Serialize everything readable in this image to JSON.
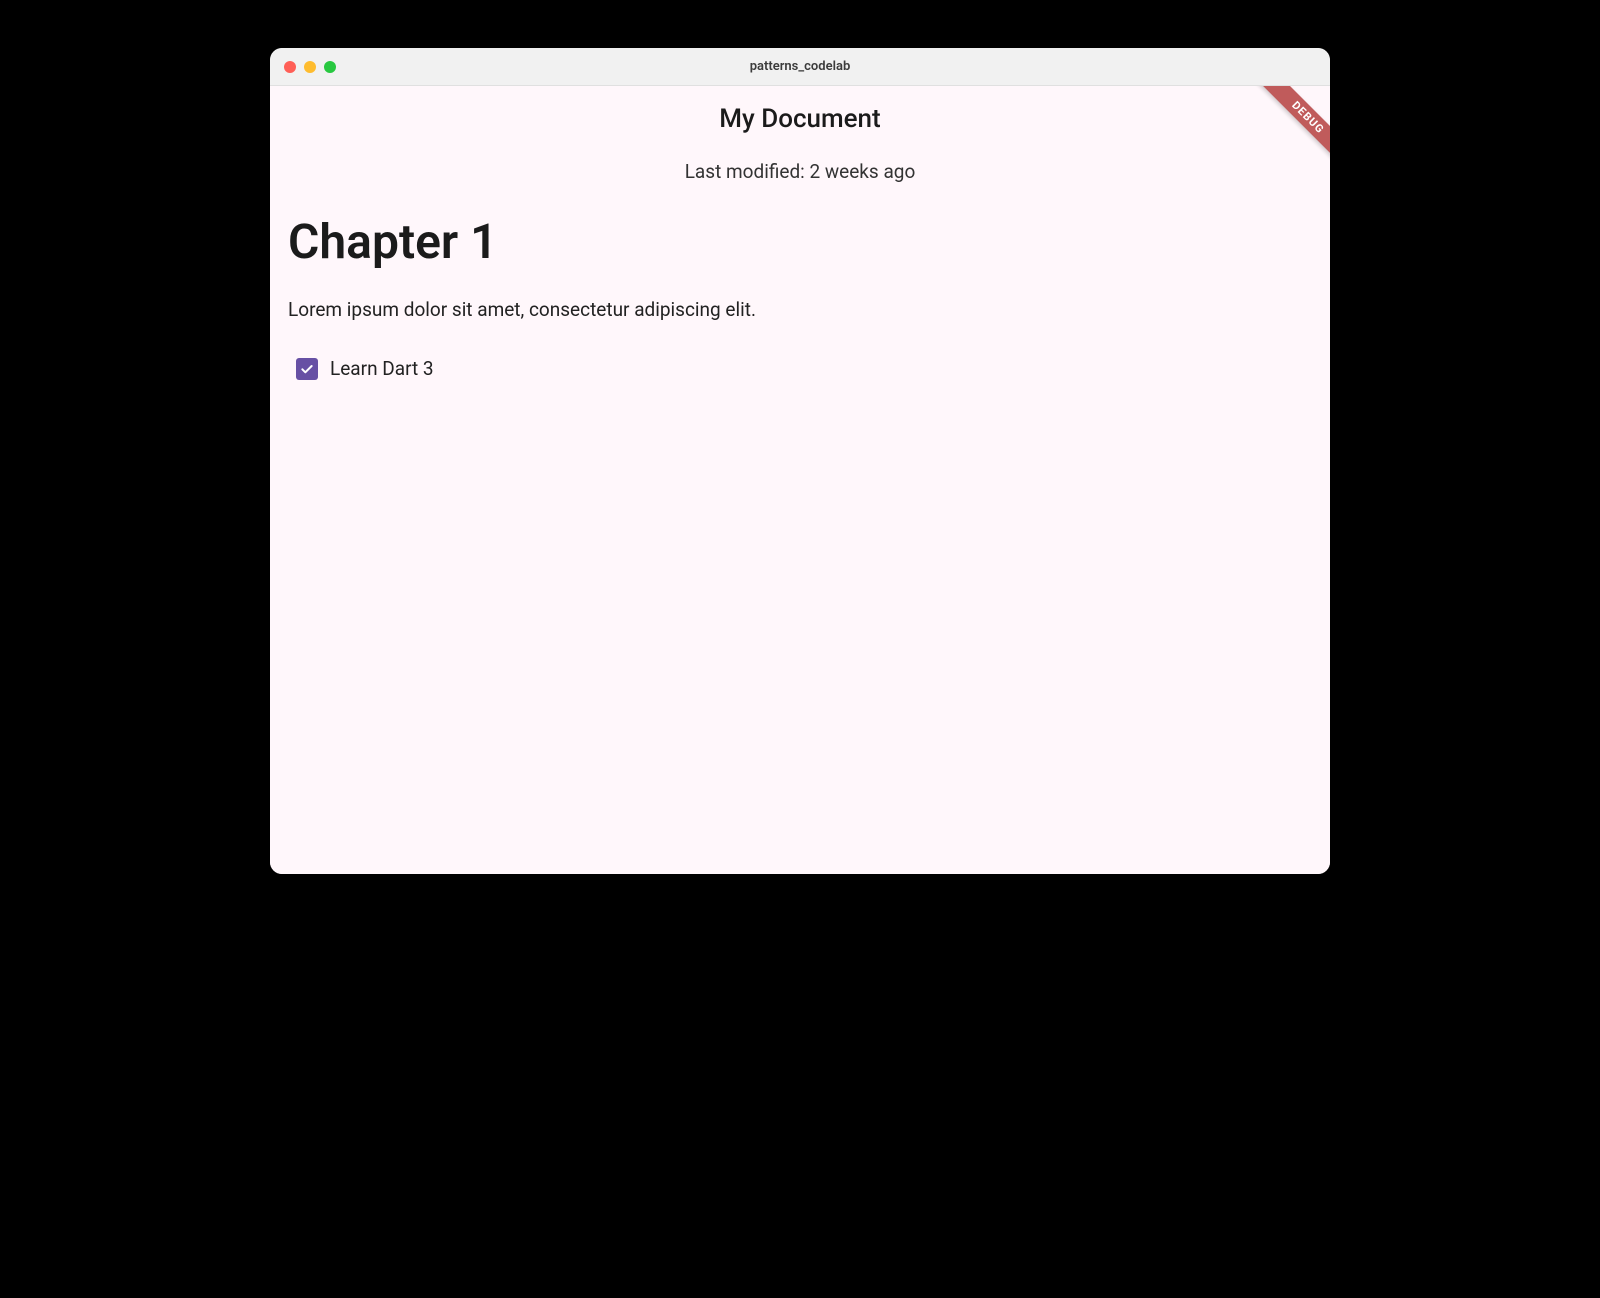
{
  "window": {
    "title": "patterns_codelab"
  },
  "badge": {
    "label": "DEBUG"
  },
  "appbar": {
    "title": "My Document",
    "subtitle": "Last modified: 2 weeks ago"
  },
  "content": {
    "heading": "Chapter 1",
    "paragraph": "Lorem ipsum dolor sit amet, consectetur adipiscing elit."
  },
  "todo": {
    "label": "Learn Dart 3",
    "checked": true
  },
  "colors": {
    "surface": "#fff7fb",
    "primary": "#6750a4",
    "debugBanner": "#c05b5b"
  }
}
